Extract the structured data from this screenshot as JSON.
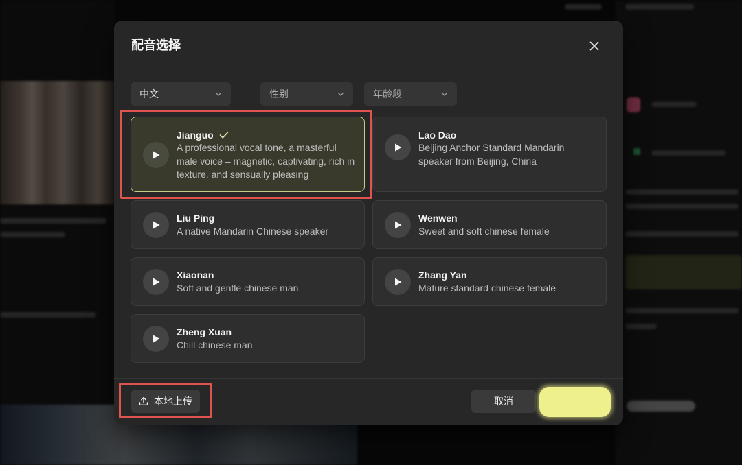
{
  "dialog": {
    "title": "配音选择"
  },
  "filters": {
    "language": "中文",
    "gender": "性别",
    "age": "年龄段"
  },
  "voices": [
    {
      "name": "Jianguo",
      "description": "A professional vocal tone, a masterful male voice – magnetic, captivating, rich in texture, and sensually pleasing",
      "selected": true
    },
    {
      "name": "Lao Dao",
      "description": "Beijing Anchor Standard Mandarin speaker from Beijing, China",
      "selected": false
    },
    {
      "name": "Liu Ping",
      "description": "A native Mandarin Chinese speaker",
      "selected": false
    },
    {
      "name": "Wenwen",
      "description": "Sweet and soft chinese female",
      "selected": false
    },
    {
      "name": "Xiaonan",
      "description": "Soft and gentle chinese man",
      "selected": false
    },
    {
      "name": "Zhang Yan",
      "description": "Mature standard chinese female",
      "selected": false
    },
    {
      "name": "Zheng Xuan",
      "description": "Chill chinese man",
      "selected": false
    }
  ],
  "footer": {
    "upload_label": "本地上传",
    "cancel_label": "取消",
    "confirm_label": ""
  },
  "colors": {
    "selected_border": "#c8cc86",
    "confirm_highlight": "#eef08c",
    "annotation_red": "#e0544f"
  },
  "icons": {
    "close": "close-icon",
    "check": "check-icon",
    "play": "play-icon",
    "chevron": "chevron-down-icon",
    "upload": "upload-icon"
  }
}
